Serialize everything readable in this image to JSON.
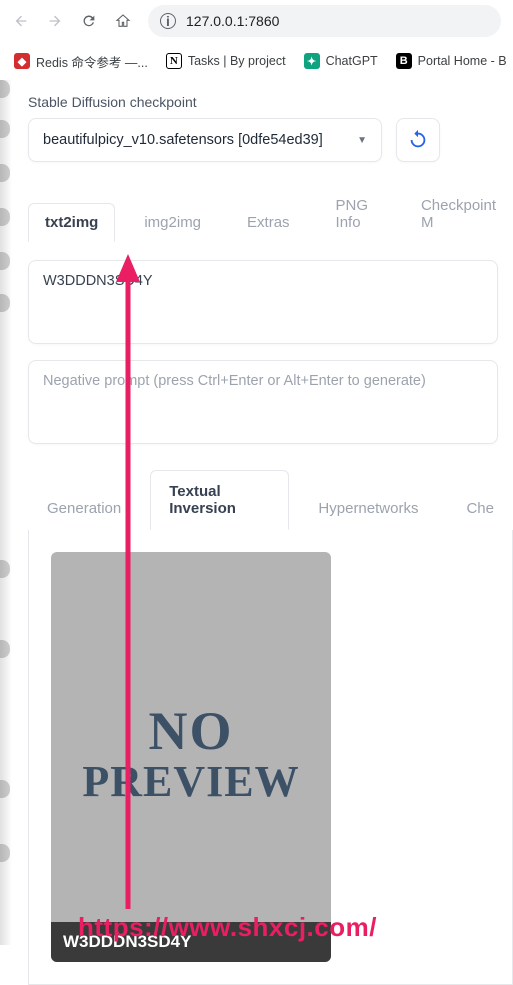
{
  "browser": {
    "url": "127.0.0.1:7860",
    "bookmarks": [
      {
        "icon": "redis",
        "label": "Redis 命令参考 —..."
      },
      {
        "icon": "notion",
        "label": "Tasks | By project"
      },
      {
        "icon": "chatgpt",
        "label": "ChatGPT"
      },
      {
        "icon": "portal",
        "label": "Portal Home - B"
      }
    ]
  },
  "app": {
    "checkpoint_label": "Stable Diffusion checkpoint",
    "checkpoint_value": "beautifulpicy_v10.safetensors [0dfe54ed39]",
    "main_tabs": [
      "txt2img",
      "img2img",
      "Extras",
      "PNG Info",
      "Checkpoint M"
    ],
    "active_main_tab": 0,
    "prompt": "W3DDDN3SD4Y",
    "negative_prompt": "",
    "negative_placeholder": "Negative prompt (press Ctrl+Enter or Alt+Enter to generate)",
    "sub_tabs": [
      "Generation",
      "Textual Inversion",
      "Hypernetworks",
      "Che"
    ],
    "active_sub_tab": 1,
    "card": {
      "preview_line1": "NO",
      "preview_line2": "PREVIEW",
      "label": "W3DDDN3SD4Y"
    }
  },
  "watermark": "https://www.shxcj.com/"
}
